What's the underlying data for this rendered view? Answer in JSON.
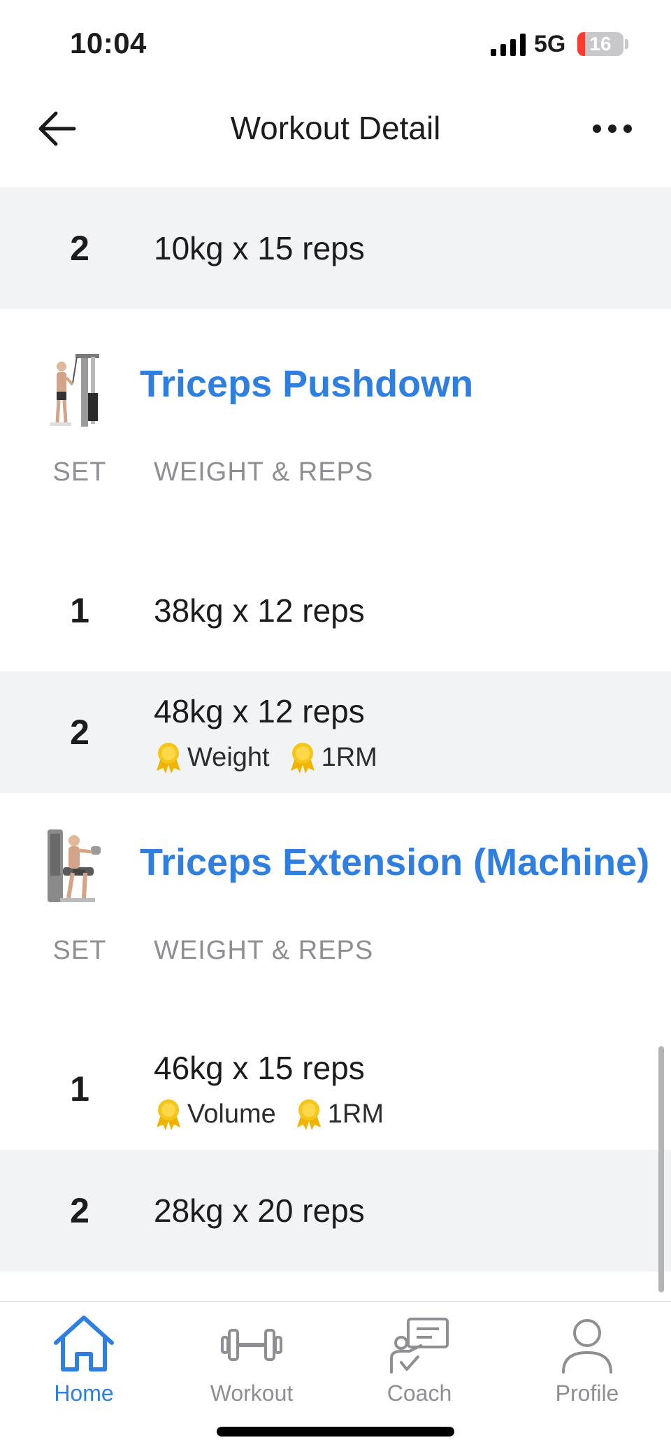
{
  "status_bar": {
    "time": "10:04",
    "network": "5G",
    "battery_level": "16",
    "battery_fraction": 0.16,
    "battery_color": "#ff3b30"
  },
  "nav": {
    "title": "Workout Detail",
    "back_icon": "arrow-left-icon",
    "more_icon": "ellipsis-icon"
  },
  "partial_previous_exercise": {
    "sets": [
      {
        "set": "2",
        "value": "10kg x 15 reps"
      }
    ]
  },
  "column_headers": {
    "set": "SET",
    "weight_reps": "WEIGHT & REPS"
  },
  "exercises": [
    {
      "name": "Triceps Pushdown",
      "thumbnail_icon": "cable-pushdown-exercise-icon",
      "sets": [
        {
          "set": "1",
          "value": "38kg x 12 reps",
          "badges": []
        },
        {
          "set": "2",
          "value": "48kg x 12 reps",
          "badges": [
            {
              "icon": "medal-icon",
              "label": "Weight"
            },
            {
              "icon": "medal-icon",
              "label": "1RM"
            }
          ]
        }
      ]
    },
    {
      "name": "Triceps Extension (Machine)",
      "thumbnail_icon": "machine-extension-exercise-icon",
      "sets": [
        {
          "set": "1",
          "value": "46kg x 15 reps",
          "badges": [
            {
              "icon": "medal-icon",
              "label": "Volume"
            },
            {
              "icon": "medal-icon",
              "label": "1RM"
            }
          ]
        },
        {
          "set": "2",
          "value": "28kg x 20 reps",
          "badges": []
        }
      ]
    }
  ],
  "tab_bar": {
    "tabs": [
      {
        "label": "Home",
        "icon": "home-icon",
        "active": true
      },
      {
        "label": "Workout",
        "icon": "dumbbell-icon",
        "active": false
      },
      {
        "label": "Coach",
        "icon": "coach-icon",
        "active": false
      },
      {
        "label": "Profile",
        "icon": "profile-icon",
        "active": false
      }
    ]
  },
  "colors": {
    "accent": "#2f7fe0",
    "row_shade": "#f2f3f5",
    "medal": "#f5c518",
    "muted": "#8e8e93"
  }
}
